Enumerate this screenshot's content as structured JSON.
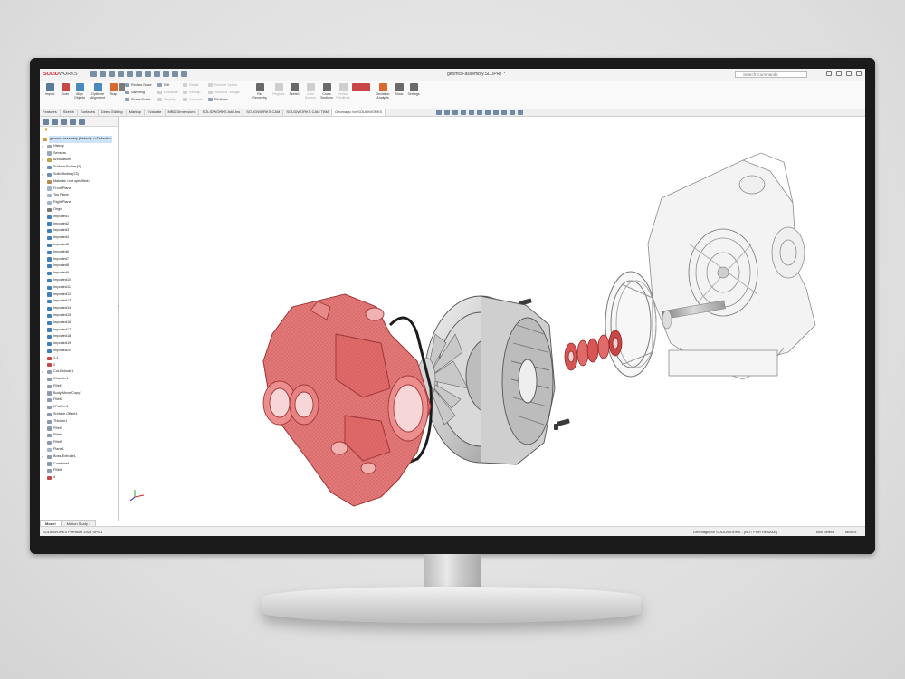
{
  "app": {
    "logo_brand": "SOLID",
    "logo_rest": "WORKS",
    "document_title": "geomco-assembly.SLDPRT *",
    "search_placeholder": "Search Commands"
  },
  "ribbon": {
    "buttons": [
      {
        "label": "Import",
        "color": "#5c7a99"
      },
      {
        "label": "Scan",
        "color": "#c94646"
      },
      {
        "label": "Align Objects",
        "color": "#4a88c0"
      },
      {
        "label": "Optimize Alignment",
        "color": "#4a88c0"
      },
      {
        "label": "Wrap",
        "color": "#d86b2c"
      },
      {
        "label": "Mesh Fit",
        "color": "#7a7a7a"
      }
    ],
    "small": [
      {
        "label": "Edit",
        "enabled": true
      },
      {
        "label": "Reduce Noise",
        "enabled": true
      },
      {
        "label": "Sampling",
        "enabled": true
      },
      {
        "label": "Shade Points",
        "enabled": true
      },
      {
        "label": "Repair",
        "enabled": false
      },
      {
        "label": "Defeature",
        "enabled": false
      },
      {
        "label": "Rewrap",
        "enabled": false
      },
      {
        "label": "Simplify",
        "enabled": false
      },
      {
        "label": "Decimate",
        "enabled": false
      },
      {
        "label": "Remove Spikes",
        "enabled": false
      },
      {
        "label": "Selected Triangle",
        "enabled": false
      },
      {
        "label": "Fill Holes",
        "enabled": true
      }
    ],
    "buttons2": [
      {
        "label": "Ref Geometry",
        "color": "#6a6a6a"
      },
      {
        "label": "Regions",
        "color": "#cfcfcf"
      },
      {
        "label": "Sketch",
        "color": "#6a6a6a"
      },
      {
        "label": "Auto Surface",
        "color": "#cfcfcf"
      },
      {
        "label": "Cross Sections",
        "color": "#6a6a6a"
      },
      {
        "label": "Deviation Analysis",
        "color": "#d86b2c"
      },
      {
        "label": "Show",
        "color": "#6a6a6a"
      },
      {
        "label": "Settings",
        "color": "#6a6a6a"
      }
    ],
    "extra_labels": [
      "Extract Primitives",
      "Deviation Analysis"
    ]
  },
  "command_tabs": [
    {
      "label": "Features",
      "active": false
    },
    {
      "label": "Sketch",
      "active": false
    },
    {
      "label": "Surfaces",
      "active": false
    },
    {
      "label": "Direct Editing",
      "active": false
    },
    {
      "label": "Markup",
      "active": false
    },
    {
      "label": "Evaluate",
      "active": false
    },
    {
      "label": "MBD Dimensions",
      "active": false
    },
    {
      "label": "SOLIDWORKS Add-Ins",
      "active": false
    },
    {
      "label": "SOLIDWORKS CAM",
      "active": false
    },
    {
      "label": "SOLIDWORKS CAM TBM",
      "active": false
    },
    {
      "label": "Geomagic for SOLIDWORKS",
      "active": true
    }
  ],
  "tree": {
    "root": "geomco-assembly (Default) <<Default>>",
    "items": [
      {
        "label": "History",
        "icon": "#9aa7b5",
        "expand": "›"
      },
      {
        "label": "Sensors",
        "icon": "#9aa7b5",
        "expand": ""
      },
      {
        "label": "Annotations",
        "icon": "#c2a542",
        "expand": "›"
      },
      {
        "label": "Surface Bodies(3)",
        "icon": "#6a8fb2",
        "expand": "›"
      },
      {
        "label": "Solid Bodies(23)",
        "icon": "#6a8fb2",
        "expand": "›"
      },
      {
        "label": "Material <not specified>",
        "icon": "#b58a52",
        "expand": ""
      },
      {
        "label": "Front Plane",
        "icon": "#9cb6cf",
        "expand": ""
      },
      {
        "label": "Top Plane",
        "icon": "#9cb6cf",
        "expand": ""
      },
      {
        "label": "Right Plane",
        "icon": "#9cb6cf",
        "expand": ""
      },
      {
        "label": "Origin",
        "icon": "#7a7a7a",
        "expand": ""
      },
      {
        "label": "Imported1",
        "icon": "#3f7fba",
        "expand": ""
      },
      {
        "label": "Imported2",
        "icon": "#3f7fba",
        "expand": ""
      },
      {
        "label": "Imported3",
        "icon": "#3f7fba",
        "expand": ""
      },
      {
        "label": "Imported4",
        "icon": "#3f7fba",
        "expand": ""
      },
      {
        "label": "Imported5",
        "icon": "#3f7fba",
        "expand": ""
      },
      {
        "label": "Imported6",
        "icon": "#3f7fba",
        "expand": ""
      },
      {
        "label": "Imported7",
        "icon": "#3f7fba",
        "expand": ""
      },
      {
        "label": "Imported8",
        "icon": "#3f7fba",
        "expand": ""
      },
      {
        "label": "Imported9",
        "icon": "#3f7fba",
        "expand": ""
      },
      {
        "label": "Imported10",
        "icon": "#3f7fba",
        "expand": ""
      },
      {
        "label": "Imported11",
        "icon": "#3f7fba",
        "expand": ""
      },
      {
        "label": "Imported12",
        "icon": "#3f7fba",
        "expand": ""
      },
      {
        "label": "Imported13",
        "icon": "#3f7fba",
        "expand": ""
      },
      {
        "label": "Imported14",
        "icon": "#3f7fba",
        "expand": ""
      },
      {
        "label": "Imported15",
        "icon": "#3f7fba",
        "expand": ""
      },
      {
        "label": "Imported16",
        "icon": "#3f7fba",
        "expand": ""
      },
      {
        "label": "Imported17",
        "icon": "#3f7fba",
        "expand": ""
      },
      {
        "label": "Imported18",
        "icon": "#3f7fba",
        "expand": ""
      },
      {
        "label": "Imported19",
        "icon": "#3f7fba",
        "expand": ""
      },
      {
        "label": "Imported20",
        "icon": "#3f7fba",
        "expand": ""
      },
      {
        "label": "1.1",
        "icon": "#c94646",
        "expand": ""
      },
      {
        "label": "2",
        "icon": "#c94646",
        "expand": ""
      },
      {
        "label": "Cut-Extrude1",
        "icon": "#8a9ab0",
        "expand": "›"
      },
      {
        "label": "Chamfer1",
        "icon": "#8a9ab0",
        "expand": ""
      },
      {
        "label": "Fillet1",
        "icon": "#8a9ab0",
        "expand": ""
      },
      {
        "label": "Body-Move/Copy1",
        "icon": "#8a9ab0",
        "expand": ""
      },
      {
        "label": "Fillet2",
        "icon": "#8a9ab0",
        "expand": ""
      },
      {
        "label": "LPattern1",
        "icon": "#8a9ab0",
        "expand": ""
      },
      {
        "label": "Surface-Offset1",
        "icon": "#8a9ab0",
        "expand": ""
      },
      {
        "label": "Thicken1",
        "icon": "#8a9ab0",
        "expand": ""
      },
      {
        "label": "Fillet3",
        "icon": "#8a9ab0",
        "expand": ""
      },
      {
        "label": "Fillet4",
        "icon": "#8a9ab0",
        "expand": ""
      },
      {
        "label": "Fillet5",
        "icon": "#8a9ab0",
        "expand": ""
      },
      {
        "label": "Plane1",
        "icon": "#9cb6cf",
        "expand": ""
      },
      {
        "label": "Boss-Extrude1",
        "icon": "#8a9ab0",
        "expand": "›"
      },
      {
        "label": "Combine4",
        "icon": "#8a9ab0",
        "expand": ""
      },
      {
        "label": "Fillet6",
        "icon": "#8a9ab0",
        "expand": ""
      },
      {
        "label": "4",
        "icon": "#c94646",
        "expand": ""
      }
    ],
    "bottom_tabs": [
      {
        "label": "Model",
        "active": true
      },
      {
        "label": "Motion Study 1",
        "active": false
      }
    ]
  },
  "status": {
    "left": "SOLIDWORKS Premium 2023 SP0.1",
    "right": "Geomagic for SOLIDWORKS - [NOT FOR RESALE]",
    "mode": "Box Select",
    "units": "MMGS"
  },
  "colors": {
    "scan_red": "#e06a6a",
    "accent_red": "#d2262b",
    "part_grey": "#c9c9c9"
  },
  "icons": [
    "part-icon",
    "filter-icon",
    "search-icon",
    "pin-icon",
    "view-orientation-icon"
  ]
}
